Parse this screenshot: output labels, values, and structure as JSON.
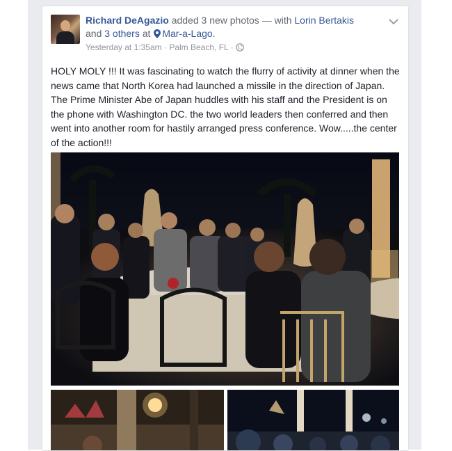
{
  "post": {
    "author": "Richard DeAgazio",
    "action": "added 3 new photos",
    "with_prefix": "— with",
    "tagged_person": "Lorin Bertakis",
    "and_text": "and",
    "others": "3 others",
    "at_text": "at",
    "place": "Mar-a-Lago.",
    "timestamp": "Yesterday at 1:35am",
    "location": "Palm Beach, FL",
    "separator": "·",
    "privacy_icon": "globe-icon",
    "text": "HOLY MOLY !!! It was fascinating to watch the flurry of activity at dinner when the news came that North Korea had launched a missile in the direction of Japan. The Prime Minister Abe of Japan huddles with his staff and the President is on the phone with Washington DC. the two world leaders then conferred and then went into another room for hastily arranged press conference. Wow.....the center of the action!!!"
  },
  "photos": {
    "count": 3,
    "icons": [
      "photo-dinner-terrace",
      "photo-dinner-flowers",
      "photo-dinner-crowd"
    ]
  },
  "colors": {
    "link": "#365899",
    "text": "#1d2129",
    "meta": "#90949c",
    "background": "#e9ebee"
  }
}
